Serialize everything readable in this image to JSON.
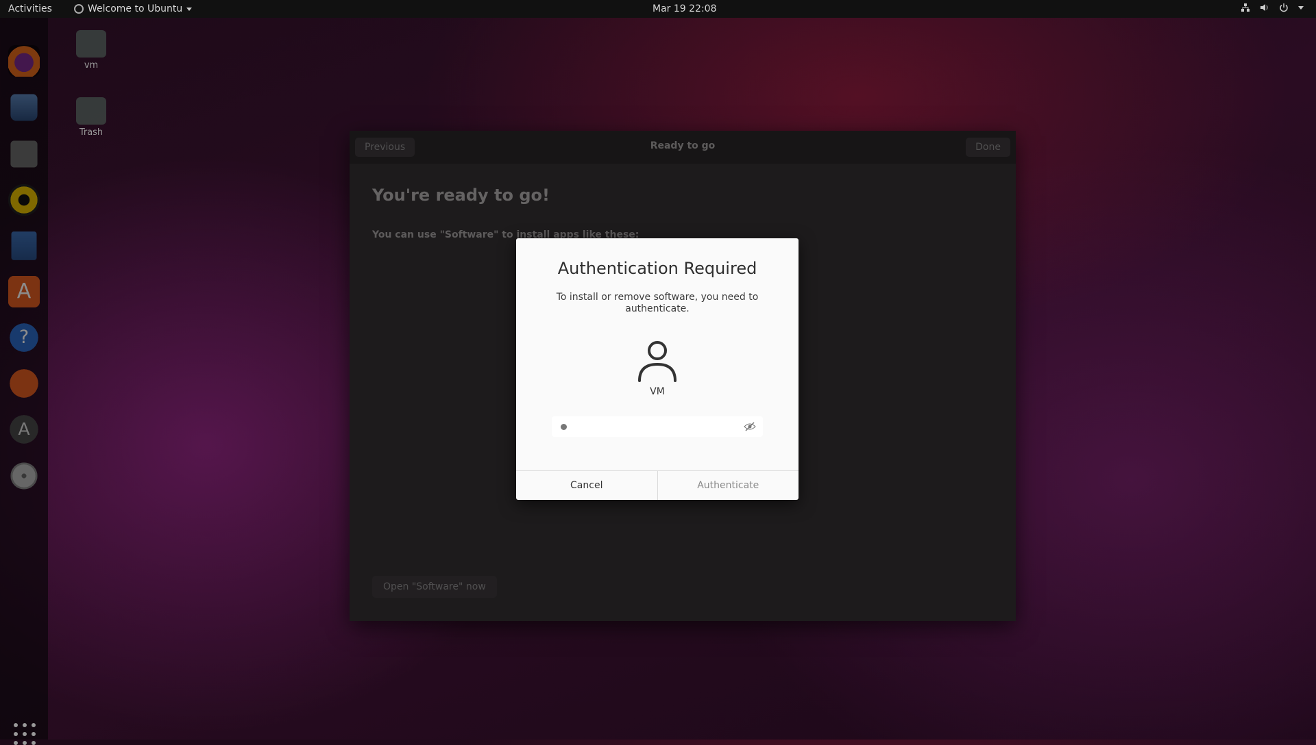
{
  "topbar": {
    "activities": "Activities",
    "app_menu": "Welcome to Ubuntu",
    "clock": "Mar 19  22:08",
    "tray_icons": [
      "network-icon",
      "volume-icon",
      "power-icon",
      "chevron-down-icon"
    ]
  },
  "dock": {
    "items": [
      "firefox-icon",
      "thunderbird-icon",
      "files-icon",
      "rhythmbox-icon",
      "libreoffice-writer-icon",
      "ubuntu-software-icon",
      "help-icon",
      "ubuntu-icon",
      "software-updater-icon",
      "dvd-icon"
    ],
    "app_grid": "show-applications-icon"
  },
  "desktop": {
    "icons": [
      {
        "label": "vm"
      },
      {
        "label": "Trash"
      }
    ]
  },
  "background_window": {
    "previous": "Previous",
    "title": "Ready to go",
    "done": "Done",
    "heading": "You're ready to go!",
    "subtext": "You can use \"Software\" to install apps like these:",
    "open_button": "Open \"Software\" now"
  },
  "auth_dialog": {
    "title": "Authentication Required",
    "message": "To install or remove software, you need to authenticate.",
    "username": "VM",
    "password_value": "•",
    "cancel": "Cancel",
    "authenticate": "Authenticate"
  }
}
